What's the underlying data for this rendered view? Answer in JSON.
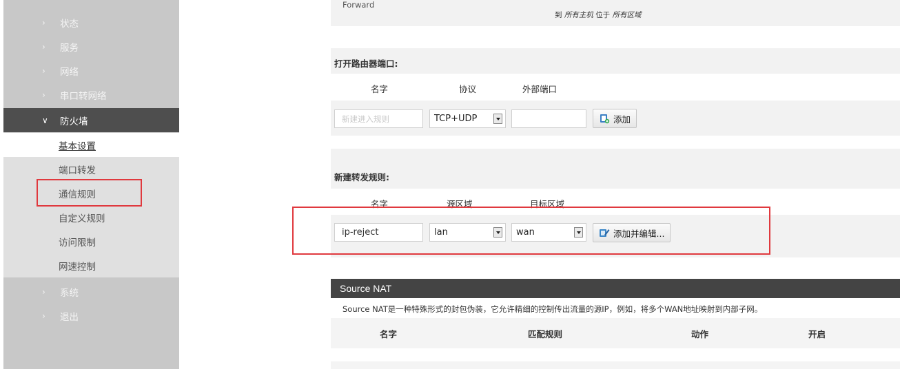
{
  "sidebar": {
    "items": [
      {
        "label": "状态"
      },
      {
        "label": "服务"
      },
      {
        "label": "网络"
      },
      {
        "label": "串口转网络"
      },
      {
        "label": "防火墙"
      },
      {
        "label": "系统"
      },
      {
        "label": "退出"
      }
    ],
    "firewall_sub": [
      {
        "label": "基本设置"
      },
      {
        "label": "端口转发"
      },
      {
        "label": "通信规则"
      },
      {
        "label": "自定义规则"
      },
      {
        "label": "访问限制"
      },
      {
        "label": "网速控制"
      }
    ]
  },
  "top_rule": {
    "forward_label": "Forward",
    "desc_prefix": "到",
    "desc_hosts": "所有主机",
    "desc_mid": "位于",
    "desc_zones": "所有区域"
  },
  "open_port": {
    "title": "打开路由器端口:",
    "col_name": "名字",
    "col_proto": "协议",
    "col_ext_port": "外部端口",
    "name_placeholder": "新建进入规则",
    "proto_value": "TCP+UDP",
    "ext_port_value": "",
    "add_label": "添加"
  },
  "new_forward": {
    "title": "新建转发规则:",
    "col_name": "名字",
    "col_src": "源区域",
    "col_dst": "目标区域",
    "name_value": "ip-reject",
    "src_value": "lan",
    "dst_value": "wan",
    "add_edit_label": "添加并编辑..."
  },
  "snat": {
    "title": "Source NAT",
    "description": "Source NAT是一种特殊形式的封包伪装，它允许精细的控制传出流量的源IP，例如，将多个WAN地址映射到内部子网。",
    "columns": [
      "名字",
      "匹配规则",
      "动作",
      "开启"
    ]
  },
  "colors": {
    "highlight": "#e0393e",
    "active_nav": "#4e4e4e",
    "sidebar_bg": "#c8c8c8"
  }
}
